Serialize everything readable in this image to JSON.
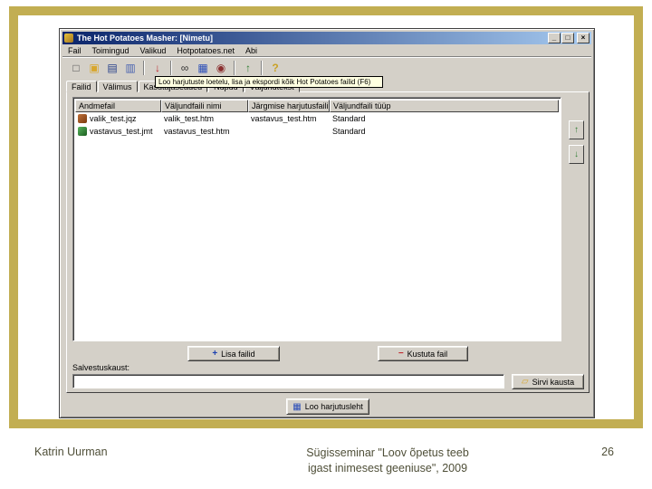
{
  "slide": {
    "footer": {
      "author": "Katrin Uurman",
      "event_line1": "Sügisseminar \"Loov õpetus teeb",
      "event_line2": "igast inimesest geeniuse\", 2009",
      "page": "26"
    }
  },
  "window": {
    "title": "The Hot Potatoes Masher: [Nimetu]",
    "window_buttons": {
      "minimize": "_",
      "maximize": "□",
      "close": "×"
    },
    "menus": [
      "Fail",
      "Toimingud",
      "Valikud",
      "Hotpotatoes.net",
      "Abi"
    ],
    "toolbar": [
      {
        "name": "new-file",
        "glyph": "□"
      },
      {
        "name": "open-folder",
        "glyph": "▣"
      },
      {
        "name": "save",
        "glyph": "▤"
      },
      {
        "name": "save-as",
        "glyph": "▥"
      },
      {
        "name": "export",
        "glyph": "↓"
      },
      {
        "name": "preview",
        "glyph": "∞"
      },
      {
        "name": "masher-grid",
        "glyph": "▦"
      },
      {
        "name": "link",
        "glyph": "◉"
      },
      {
        "name": "upload",
        "glyph": "↑"
      },
      {
        "name": "help",
        "glyph": "?"
      }
    ],
    "hint": "Loo harjutuste loetelu, lisa ja ekspordi kõik Hot Potatoes failid (F6)",
    "tabs": [
      "Failid",
      "Välimus",
      "Kasutajaseaded",
      "Nupud",
      "Väljundtekst"
    ],
    "files": {
      "columns": [
        "Andmefail",
        "Väljundfaili nimi",
        "Järgmise harjutusfaili...",
        "Väljundfaili tüüp"
      ],
      "rows": [
        {
          "data_file": "valik_test.jqz",
          "output_file": "valik_test.htm",
          "next_file": "vastavus_test.htm",
          "type": "Standard"
        },
        {
          "data_file": "vastavus_test.jmt",
          "output_file": "vastavus_test.htm",
          "next_file": "",
          "type": "Standard"
        }
      ]
    },
    "buttons": {
      "add_sign": "+",
      "add": "Lisa failid",
      "delete_sign": "−",
      "delete": "Kustuta fail",
      "move_up": "↑",
      "move_down": "↓",
      "browse_glyph": "▱",
      "browse": "Sirvi kausta",
      "build_glyph": "▦",
      "build": "Loo harjutusleht"
    },
    "folder": {
      "label": "Salvestuskaust:",
      "value": ""
    }
  },
  "colors": {
    "slide_frame": "#c2ae52",
    "titlebar_start": "#0a246a",
    "titlebar_end": "#a6caf0",
    "chrome": "#d4d0c8",
    "tooltip_bg": "#ffffe1",
    "footer_text": "#4f4f38"
  }
}
